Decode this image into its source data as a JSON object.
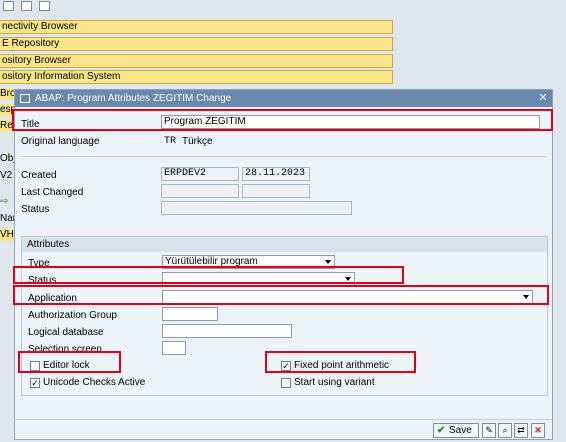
{
  "background": {
    "menu_items": [
      "nectivity Browser",
      "E Repository",
      "ository Browser",
      "ository Information System"
    ],
    "left_fragments": [
      "Brov",
      "esp",
      "Re",
      "Obje",
      "V2",
      "Nan",
      "VHC"
    ]
  },
  "dialog": {
    "title": "ABAP: Program Attributes ZEGITIM Change",
    "title_label": "Title",
    "title_value": "Program ZEGITIM",
    "orig_lang_label": "Original language",
    "orig_lang_code": "TR",
    "orig_lang_name": "Türkçe",
    "created_label": "Created",
    "created_user": "ERPDEV2",
    "created_date": "28.11.2023",
    "last_changed_label": "Last Changed",
    "status_label": "Status",
    "attributes": {
      "header": "Attributes",
      "type_label": "Type",
      "type_value": "Yürütülebilir program",
      "status_label": "Status",
      "application_label": "Application",
      "auth_group_label": "Authorization Group",
      "logical_db_label": "Logical database",
      "selection_screen_label": "Selection screen",
      "editor_lock_label": "Editor lock",
      "unicode_label": "Unicode Checks Active",
      "fixed_point_label": "Fixed point arithmetic",
      "start_variant_label": "Start using variant"
    },
    "save_label": "Save"
  },
  "colors": {
    "highlight": "#e0001a",
    "titlebar": "#6a87ac",
    "menu": "#f9e68a"
  }
}
